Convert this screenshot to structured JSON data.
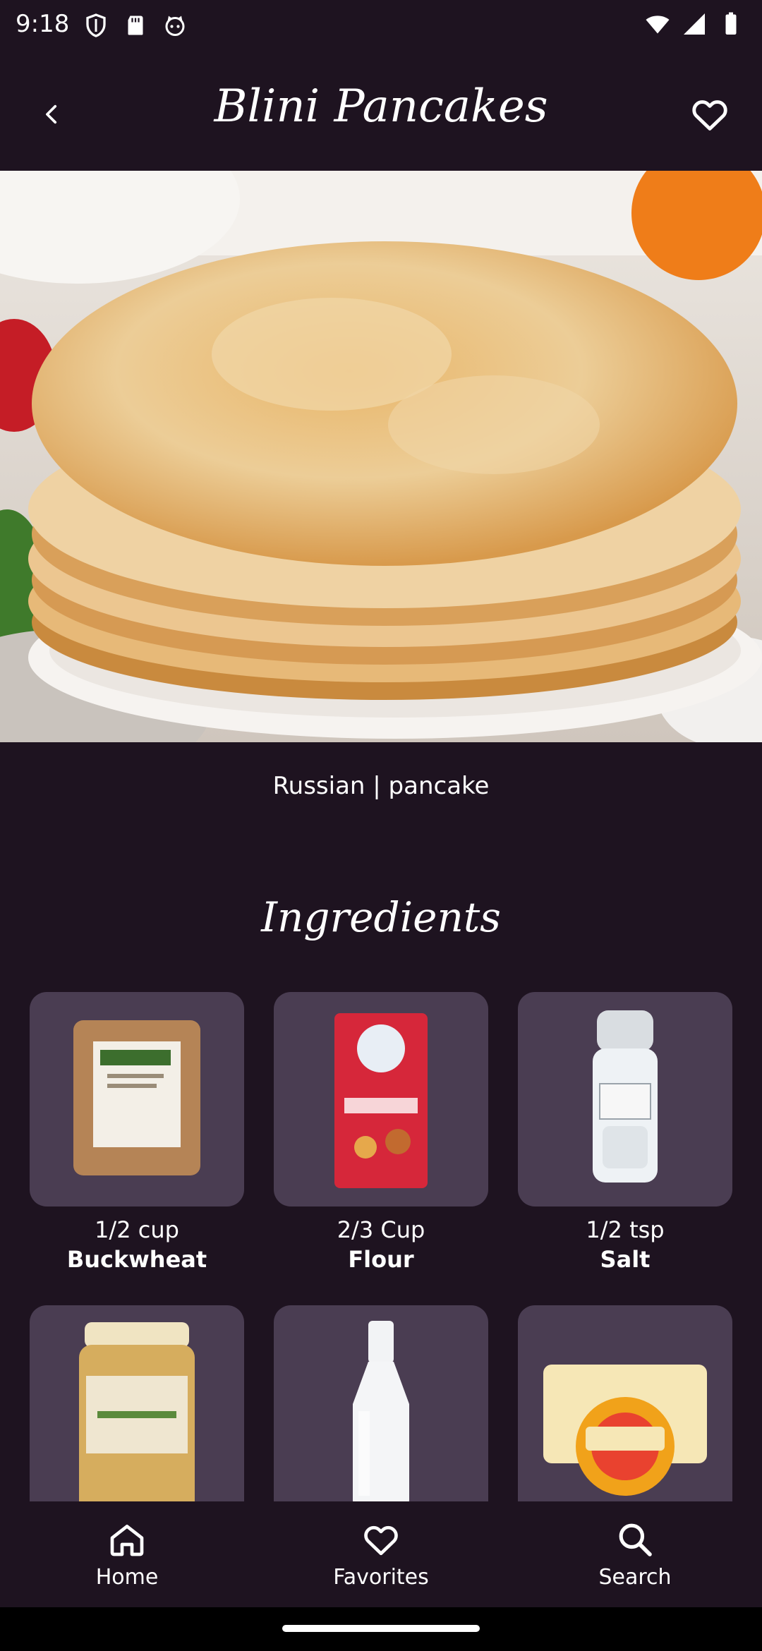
{
  "status_bar": {
    "time": "9:18",
    "icons_left": [
      "shield-icon",
      "sd-card-icon",
      "cat-icon"
    ],
    "icons_right": [
      "wifi-icon",
      "signal-icon",
      "battery-icon"
    ]
  },
  "header": {
    "title": "Blini Pancakes",
    "back_icon": "chevron-left-icon",
    "favorite_icon": "heart-outline-icon"
  },
  "recipe": {
    "tags": "Russian | pancake"
  },
  "ingredients": {
    "heading": "Ingredients",
    "items": [
      {
        "qty": "1/2 cup",
        "name": "Buckwheat"
      },
      {
        "qty": "2/3 Cup",
        "name": "Flour"
      },
      {
        "qty": "1/2 tsp",
        "name": "Salt"
      },
      {
        "qty": "",
        "name": ""
      },
      {
        "qty": "",
        "name": ""
      },
      {
        "qty": "",
        "name": ""
      }
    ]
  },
  "bottom_nav": {
    "items": [
      {
        "label": "Home",
        "icon": "home-icon"
      },
      {
        "label": "Favorites",
        "icon": "heart-outline-icon"
      },
      {
        "label": "Search",
        "icon": "search-icon"
      }
    ]
  },
  "colors": {
    "background": "#1e1320",
    "card": "#4a3d52"
  }
}
